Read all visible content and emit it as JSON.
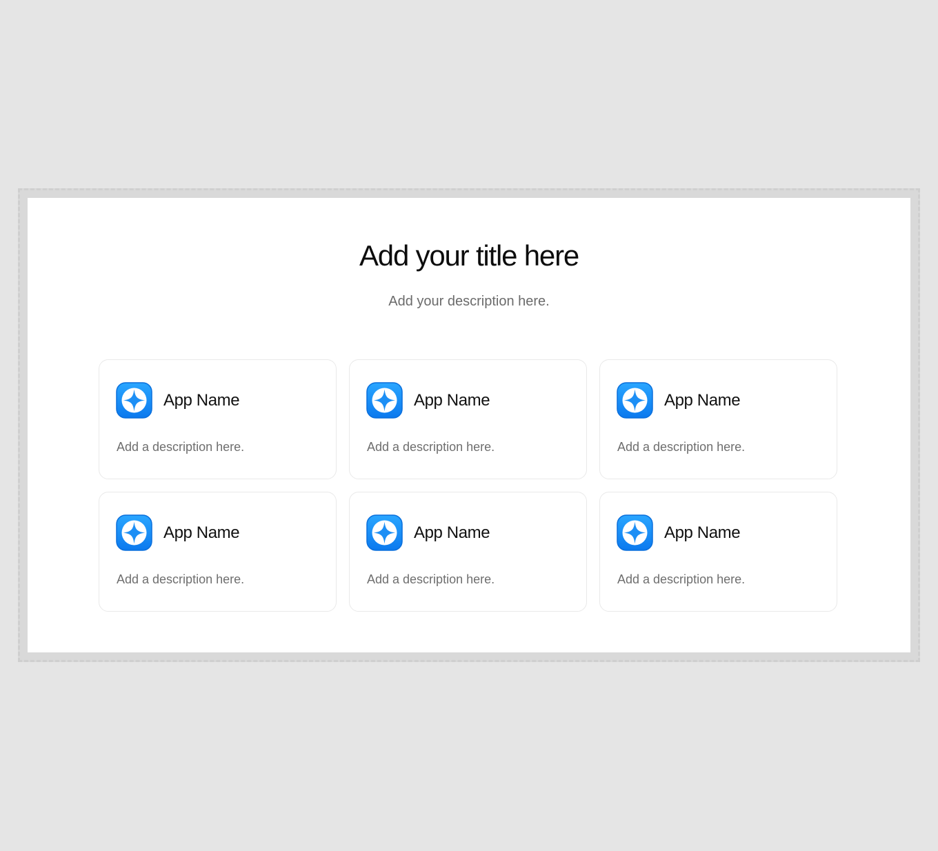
{
  "header": {
    "title": "Add your title here",
    "description": "Add your description here."
  },
  "colors": {
    "icon_blue": "#1493f5",
    "icon_blue_dark": "#0a6fdc",
    "card_border": "#e9e9e9",
    "description_gray": "#6e6e6e"
  },
  "apps": [
    {
      "icon": "sparkle-app-icon",
      "name": "App Name",
      "description": "Add a description here."
    },
    {
      "icon": "sparkle-app-icon",
      "name": "App Name",
      "description": "Add a description here."
    },
    {
      "icon": "sparkle-app-icon",
      "name": "App Name",
      "description": "Add a description here."
    },
    {
      "icon": "sparkle-app-icon",
      "name": "App Name",
      "description": "Add a description here."
    },
    {
      "icon": "sparkle-app-icon",
      "name": "App Name",
      "description": "Add a description here."
    },
    {
      "icon": "sparkle-app-icon",
      "name": "App Name",
      "description": "Add a description here."
    }
  ]
}
